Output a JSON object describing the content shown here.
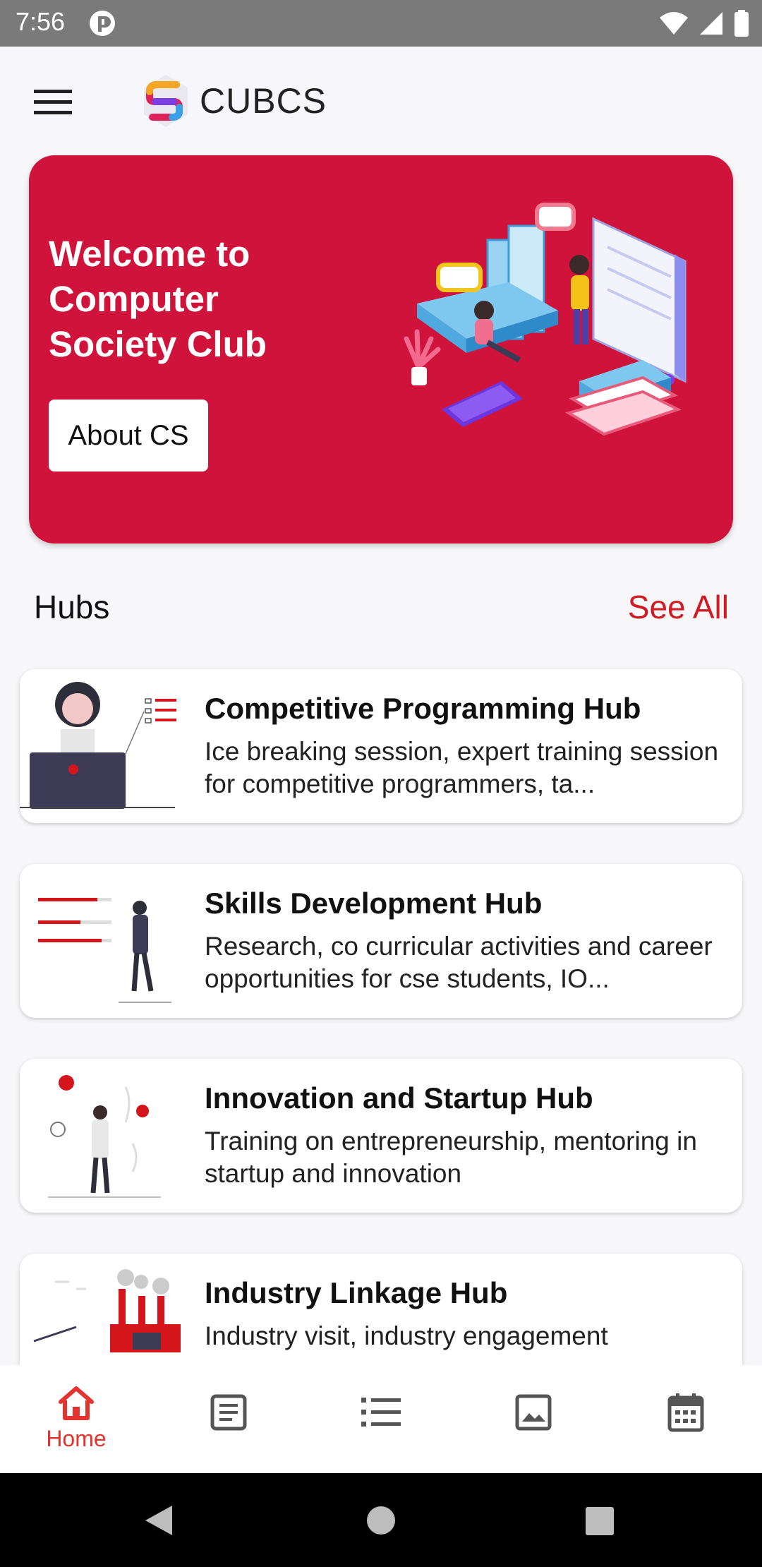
{
  "status_bar": {
    "time": "7:56"
  },
  "app_bar": {
    "title": "CUBCS"
  },
  "hero": {
    "title": "Welcome to Computer Society Club",
    "button_label": "About CS"
  },
  "hubs": {
    "heading": "Hubs",
    "see_all": "See All",
    "items": [
      {
        "title": "Competitive Programming Hub",
        "description": "Ice breaking session, expert training session for competitive programmers, ta..."
      },
      {
        "title": "Skills Development Hub",
        "description": "Research, co curricular activities and career opportunities for cse students, IO..."
      },
      {
        "title": "Innovation and Startup Hub",
        "description": "Training on entrepreneurship, mentoring in startup and innovation"
      },
      {
        "title": "Industry Linkage Hub",
        "description": "Industry visit, industry engagement"
      }
    ]
  },
  "bottom_nav": {
    "items": [
      {
        "icon": "home-icon",
        "label": "Home",
        "active": true
      },
      {
        "icon": "article-icon",
        "label": "",
        "active": false
      },
      {
        "icon": "list-icon",
        "label": "",
        "active": false
      },
      {
        "icon": "image-icon",
        "label": "",
        "active": false
      },
      {
        "icon": "calendar-icon",
        "label": "",
        "active": false
      }
    ]
  },
  "colors": {
    "accent": "#cf133a",
    "active_nav": "#e3342f",
    "see_all": "#d01c24"
  }
}
